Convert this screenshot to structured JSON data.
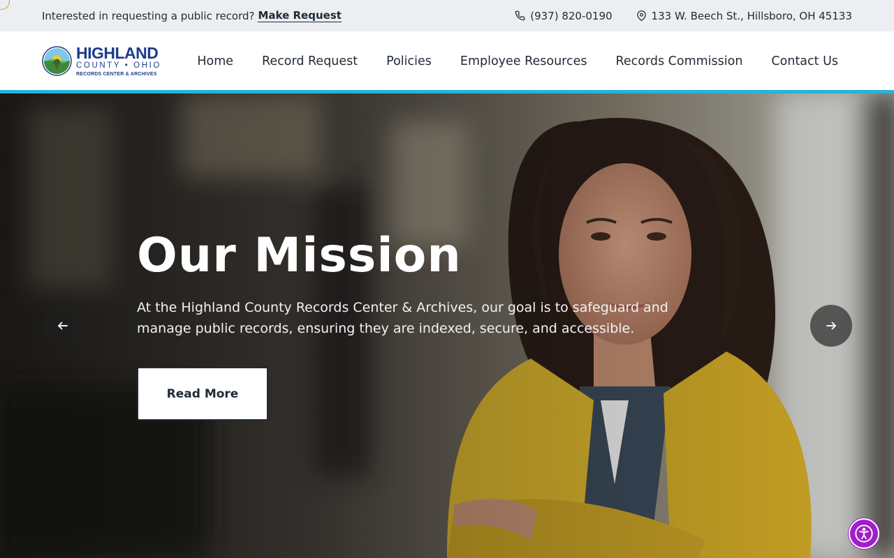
{
  "topbar": {
    "prompt": "Interested in requesting a public record?",
    "request_link": "Make Request",
    "phone": "(937) 820-0190",
    "address": "133 W. Beech St., Hillsboro, OH 45133"
  },
  "logo": {
    "line1": "HIGHLAND",
    "line2": "COUNTY • OHIO",
    "line3": "RECORDS CENTER & ARCHIVES"
  },
  "nav": {
    "items": [
      {
        "label": "Home"
      },
      {
        "label": "Record Request"
      },
      {
        "label": "Policies"
      },
      {
        "label": "Employee Resources"
      },
      {
        "label": "Records Commission"
      },
      {
        "label": "Contact Us"
      }
    ]
  },
  "hero": {
    "title": "Our Mission",
    "text": "At the Highland County Records Center & Archives, our goal is to safeguard and manage public records, ensuring they are indexed, secure, and accessible.",
    "button": "Read More"
  },
  "icons": {
    "phone": "phone-icon",
    "location": "map-pin-icon",
    "prev": "arrow-left-icon",
    "next": "arrow-right-icon",
    "accessibility": "accessibility-icon"
  },
  "colors": {
    "accent": "#29b3d6",
    "brand": "#1d3b8f",
    "accessibility": "#a020c8",
    "blazer": "#d9b42e"
  }
}
